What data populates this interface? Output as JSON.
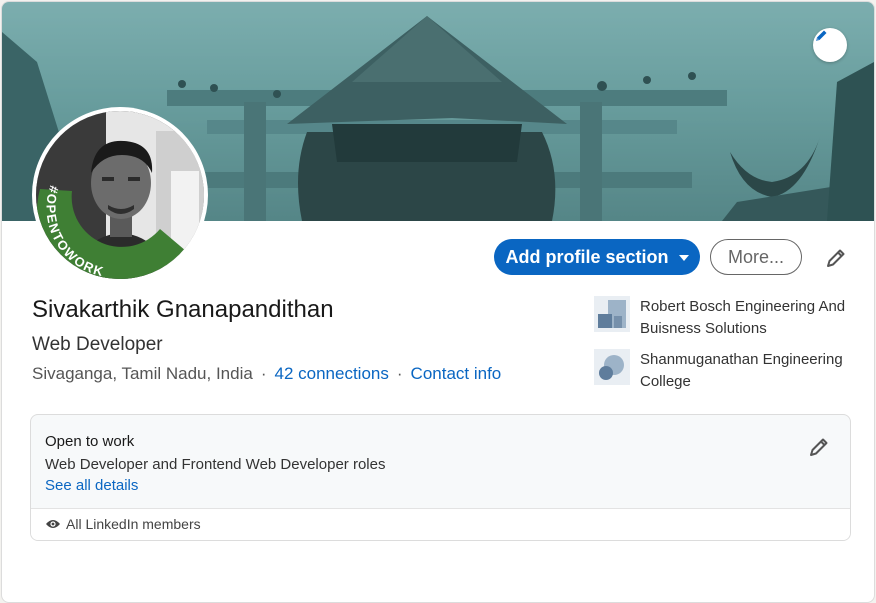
{
  "actions": {
    "add_section_label": "Add profile section",
    "more_label": "More..."
  },
  "profile": {
    "name": "Sivakarthik Gnanapandithan",
    "headline": "Web Developer",
    "location": "Sivaganga, Tamil Nadu, India",
    "separator": "·",
    "connections": "42 connections",
    "contact_info": "Contact info",
    "badge_text": "#OPENTOWORK"
  },
  "organizations": [
    {
      "name": "Robert Bosch Engineering And Buisness Solutions",
      "icon": "company-logo-icon"
    },
    {
      "name": "Shanmuganathan Engineering College",
      "icon": "school-logo-icon"
    }
  ],
  "open_to_work": {
    "title": "Open to work",
    "roles": "Web Developer and Frontend Web Developer roles",
    "details_link": "See all details",
    "visibility": "All LinkedIn members"
  },
  "colors": {
    "accent": "#0a66c2",
    "badge_green": "#3f7f34"
  }
}
